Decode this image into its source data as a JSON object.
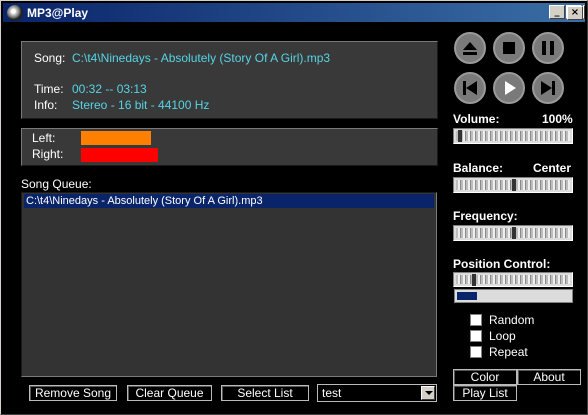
{
  "window": {
    "title": "MP3@Play",
    "minimize": "_",
    "maximize": "□",
    "close": "×"
  },
  "now_playing": {
    "song_label": "Song:",
    "song_value": "C:\\t4\\Ninedays - Absolutely (Story Of A Girl).mp3",
    "time_label": "Time:",
    "time_value": "00:32 -- 03:13",
    "info_label": "Info:",
    "info_value": "Stereo - 16 bit - 44100 Hz"
  },
  "levels": {
    "left_label": "Left:",
    "right_label": "Right:",
    "left_color": "#ff8000",
    "right_color": "#ff0000",
    "left_level": 0.55,
    "right_level": 0.6
  },
  "queue": {
    "label": "Song Queue:",
    "items": [
      "C:\\t4\\Ninedays - Absolutely (Story Of A Girl).mp3"
    ]
  },
  "controls": {
    "eject_icon": "eject-icon",
    "stop_icon": "stop-icon",
    "pause_icon": "pause-icon",
    "prev_icon": "skip-back-icon",
    "play_icon": "play-icon",
    "next_icon": "skip-forward-icon"
  },
  "sliders": {
    "volume_label": "Volume:",
    "volume_value": "100%",
    "balance_label": "Balance:",
    "balance_value": "Center",
    "frequency_label": "Frequency:",
    "position_label": "Position Control:",
    "position_progress": 0.17
  },
  "options": {
    "random": "Random",
    "loop": "Loop",
    "repeat": "Repeat"
  },
  "buttons": {
    "remove_song": "Remove Song",
    "clear_queue": "Clear Queue",
    "select_list": "Select List",
    "color": "Color",
    "about": "About",
    "play_list": "Play List"
  },
  "list_select": {
    "value": "test"
  },
  "colors": {
    "info_text": "#55d4e6",
    "selection": "#0a246a"
  }
}
